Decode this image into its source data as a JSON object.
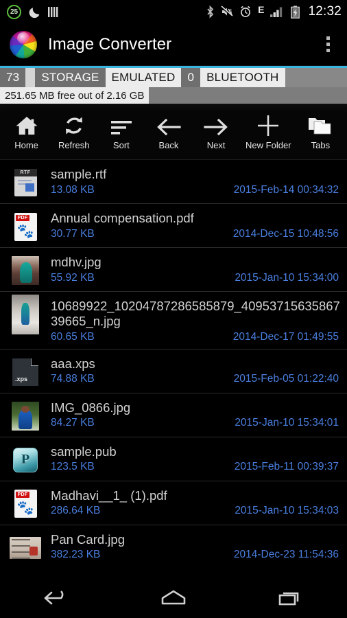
{
  "status_bar": {
    "dnd_count": "25",
    "time": "12:32",
    "icons": [
      "dnd-badge-25",
      "moon-icon",
      "bars-icon",
      "bluetooth-icon",
      "volume-mute-icon",
      "alarm-clock-icon",
      "edge-network-icon",
      "signal-bars-icon",
      "battery-charging-icon"
    ]
  },
  "app_bar": {
    "title": "Image Converter",
    "app_icon": "color-wheel-icon",
    "overflow_icon": "overflow-menu-icon"
  },
  "breadcrumb": {
    "segments": [
      {
        "label": "73",
        "style": "dark"
      },
      {
        "label": "STORAGE",
        "style": "dark"
      },
      {
        "label": "EMULATED",
        "style": "light"
      },
      {
        "label": "0",
        "style": "dark"
      },
      {
        "label": "BLUETOOTH",
        "style": "light"
      }
    ],
    "storage_info": "251.65 MB free out of 2.16 GB",
    "accent_color": "#3ab5e0"
  },
  "toolbar": {
    "items": [
      {
        "label": "Home",
        "icon": "home-icon"
      },
      {
        "label": "Refresh",
        "icon": "refresh-icon"
      },
      {
        "label": "Sort",
        "icon": "sort-icon"
      },
      {
        "label": "Back",
        "icon": "arrow-left-icon"
      },
      {
        "label": "Next",
        "icon": "arrow-right-icon"
      },
      {
        "label": "New Folder",
        "icon": "plus-icon"
      },
      {
        "label": "Tabs",
        "icon": "folders-icon"
      }
    ]
  },
  "file_list": {
    "size_color": "#4a7fe0",
    "name_color": "#d2d2d2",
    "files": [
      {
        "name": "sample.rtf",
        "size": "13.08 KB",
        "date": "2015-Feb-14 00:34:32",
        "icon": "rtf-file-icon"
      },
      {
        "name": "Annual compensation.pdf",
        "size": "30.77 KB",
        "date": "2014-Dec-15 10:48:56",
        "icon": "pdf-file-icon"
      },
      {
        "name": "mdhv.jpg",
        "size": "55.92 KB",
        "date": "2015-Jan-10 15:34:00",
        "icon": "image-thumbnail"
      },
      {
        "name": "10689922_10204787286585879_4095371563586739665_n.jpg",
        "size": "60.65 KB",
        "date": "2014-Dec-17 01:49:55",
        "icon": "image-thumbnail"
      },
      {
        "name": "aaa.xps",
        "size": "74.88 KB",
        "date": "2015-Feb-05 01:22:40",
        "icon": "xps-file-icon"
      },
      {
        "name": "IMG_0866.jpg",
        "size": "84.27 KB",
        "date": "2015-Jan-10 15:34:01",
        "icon": "image-thumbnail"
      },
      {
        "name": "sample.pub",
        "size": "123.5 KB",
        "date": "2015-Feb-11 00:39:37",
        "icon": "publisher-file-icon"
      },
      {
        "name": "Madhavi__1_ (1).pdf",
        "size": "286.64 KB",
        "date": "2015-Jan-10 15:34:03",
        "icon": "pdf-file-icon"
      },
      {
        "name": "Pan Card.jpg",
        "size": "382.23 KB",
        "date": "2014-Dec-23 11:54:36",
        "icon": "image-thumbnail"
      }
    ]
  },
  "nav_bar": {
    "buttons": [
      "back-nav-icon",
      "home-nav-icon",
      "recents-nav-icon"
    ]
  }
}
